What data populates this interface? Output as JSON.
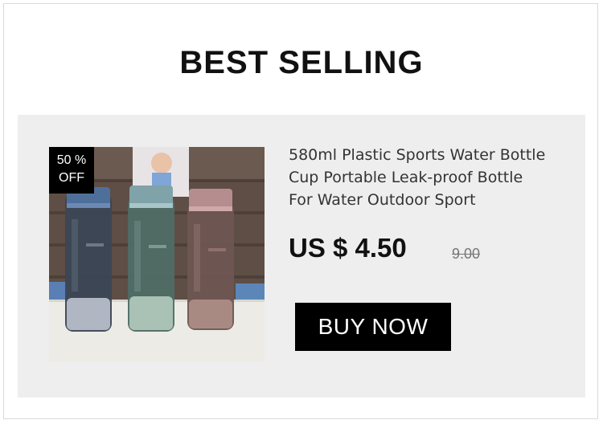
{
  "header": {
    "title": "BEST SELLING"
  },
  "product": {
    "discount_badge": {
      "line1": "50 %",
      "line2": "OFF"
    },
    "name_lines": [
      "580ml Plastic Sports Water Bottle",
      "Cup Portable Leak-proof Bottle",
      "For Water Outdoor Sport"
    ],
    "price": "US $ 4.50",
    "original_price": "9.00",
    "buy_label": "BUY NOW",
    "image_icon": "water-bottles-photo"
  },
  "colors": {
    "accent": "#000000",
    "card_background": "#eeeeee",
    "title_highlight": "#dddddd"
  }
}
